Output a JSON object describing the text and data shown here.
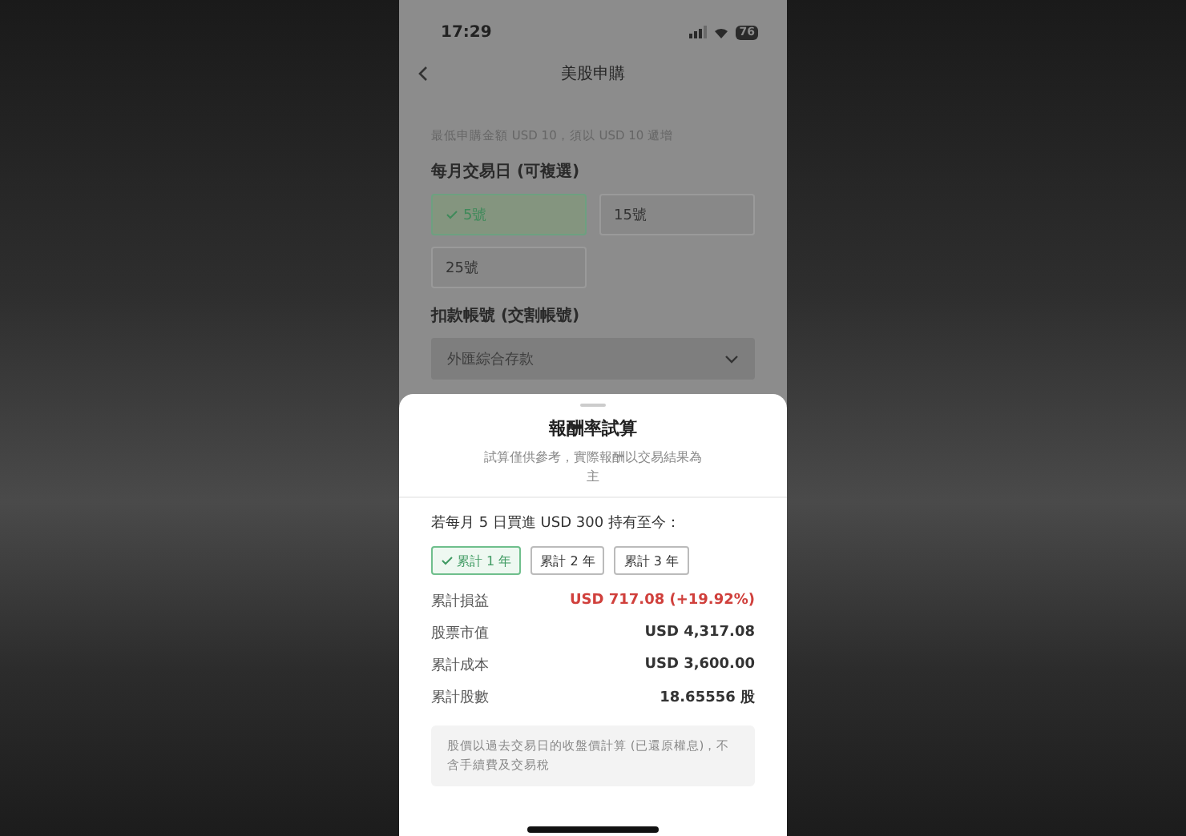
{
  "status_bar": {
    "time": "17:29",
    "battery": "76"
  },
  "nav": {
    "title": "美股申購"
  },
  "form": {
    "hint": "最低申購金額 USD 10，須以 USD 10 遞增",
    "day_label": "每月交易日 (可複選)",
    "days": [
      {
        "label": "5號",
        "selected": true
      },
      {
        "label": "15號",
        "selected": false
      },
      {
        "label": "25號",
        "selected": false
      }
    ],
    "account_label": "扣款帳號 (交割帳號)",
    "account_value": "外匯綜合存款"
  },
  "sheet": {
    "title": "報酬率試算",
    "subtitle": "試算僅供參考，實際報酬以交易結果為主",
    "question": "若每月 5 日買進 USD 300 持有至今：",
    "periods": [
      {
        "label": "累計 1 年",
        "selected": true
      },
      {
        "label": "累計 2 年",
        "selected": false
      },
      {
        "label": "累計 3 年",
        "selected": false
      }
    ],
    "rows": [
      {
        "label": "累計損益",
        "value": "USD 717.08 (+19.92%)",
        "kind": "gain"
      },
      {
        "label": "股票市值",
        "value": "USD 4,317.08",
        "kind": "plain"
      },
      {
        "label": "累計成本",
        "value": "USD 3,600.00",
        "kind": "plain"
      },
      {
        "label": "累計股數",
        "value": "18.65556 股",
        "kind": "plain"
      }
    ],
    "note": "股價以過去交易日的收盤價計算 (已還原權息)，不含手續費及交易稅"
  }
}
